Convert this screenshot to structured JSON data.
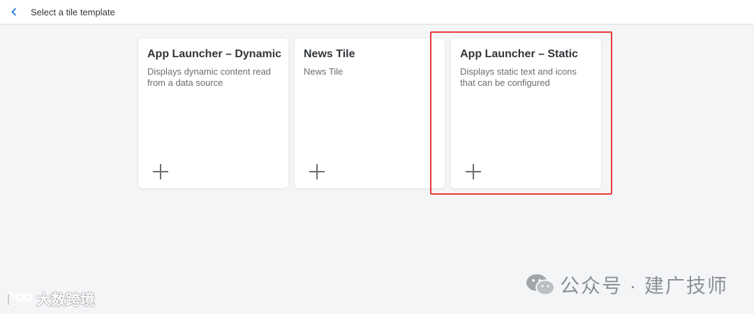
{
  "header": {
    "title": "Select a tile template",
    "back_icon": "chevron-left-icon"
  },
  "tiles": [
    {
      "title": "App Launcher – Dynamic",
      "description": "Displays dynamic content read from a data source",
      "icon": "plus-icon"
    },
    {
      "title": "News Tile",
      "description": "News Tile",
      "icon": "plus-icon"
    },
    {
      "title": "App Launcher – Static",
      "description": "Displays static text and icons that can be configured",
      "icon": "plus-icon",
      "highlighted": true
    }
  ],
  "colors": {
    "accent": "#0a6ed1",
    "highlight_border": "#e53935",
    "background": "#f4f5f7"
  },
  "watermarks": {
    "right": "公众号 · 建广技师",
    "left": "大数跨境"
  }
}
